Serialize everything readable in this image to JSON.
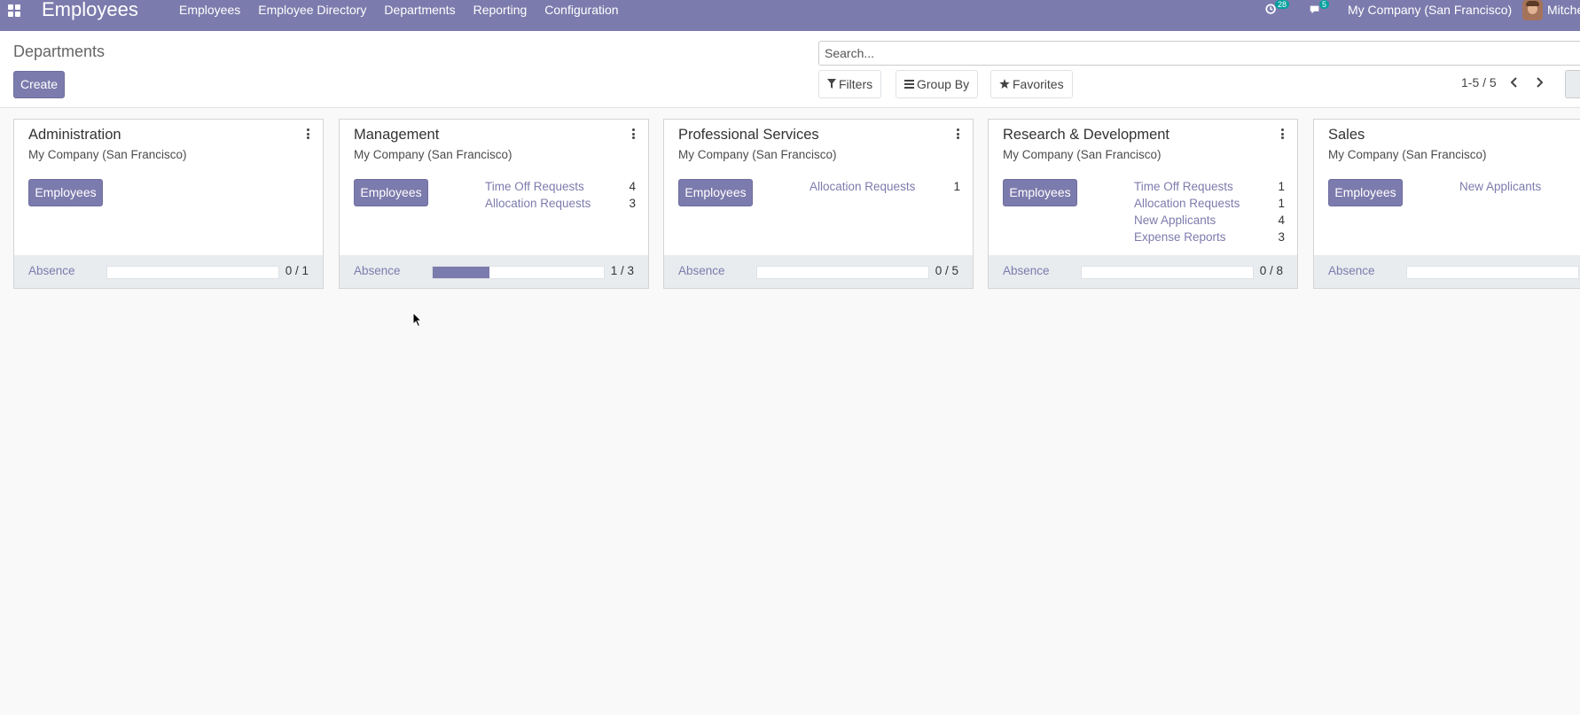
{
  "app": {
    "title": "Employees"
  },
  "menu": [
    "Employees",
    "Employee Directory",
    "Departments",
    "Reporting",
    "Configuration"
  ],
  "systray": {
    "activity_icon": "clock-icon",
    "activity_count": "28",
    "messages_icon": "chat-icon",
    "messages_count": "5",
    "company": "My Company (San Francisco)",
    "user": "Mitche"
  },
  "control_panel": {
    "breadcrumb": "Departments",
    "create_label": "Create",
    "search_placeholder": "Search...",
    "filters_label": "Filters",
    "group_by_label": "Group By",
    "favorites_label": "Favorites",
    "pager": "1-5 / 5"
  },
  "colors": {
    "primary": "#7c7bad",
    "badge": "#00a09d"
  },
  "departments": [
    {
      "name": "Administration",
      "company": "My Company (San Francisco)",
      "button": "Employees",
      "stats": [],
      "absence_label": "Absence",
      "absence": "0 / 1",
      "absence_fraction": 0
    },
    {
      "name": "Management",
      "company": "My Company (San Francisco)",
      "button": "Employees",
      "stats": [
        {
          "label": "Time Off Requests",
          "value": "4"
        },
        {
          "label": "Allocation Requests",
          "value": "3"
        }
      ],
      "absence_label": "Absence",
      "absence": "1 / 3",
      "absence_fraction": 0.333
    },
    {
      "name": "Professional Services",
      "company": "My Company (San Francisco)",
      "button": "Employees",
      "stats": [
        {
          "label": "Allocation Requests",
          "value": "1"
        }
      ],
      "absence_label": "Absence",
      "absence": "0 / 5",
      "absence_fraction": 0
    },
    {
      "name": "Research & Development",
      "company": "My Company (San Francisco)",
      "button": "Employees",
      "stats": [
        {
          "label": "Time Off Requests",
          "value": "1"
        },
        {
          "label": "Allocation Requests",
          "value": "1"
        },
        {
          "label": "New Applicants",
          "value": "4"
        },
        {
          "label": "Expense Reports",
          "value": "3"
        }
      ],
      "absence_label": "Absence",
      "absence": "0 / 8",
      "absence_fraction": 0
    },
    {
      "name": "Sales",
      "company": "My Company (San Francisco)",
      "button": "Employees",
      "stats": [
        {
          "label": "New Applicants",
          "value": ""
        }
      ],
      "absence_label": "Absence",
      "absence": "",
      "absence_fraction": 0
    }
  ]
}
